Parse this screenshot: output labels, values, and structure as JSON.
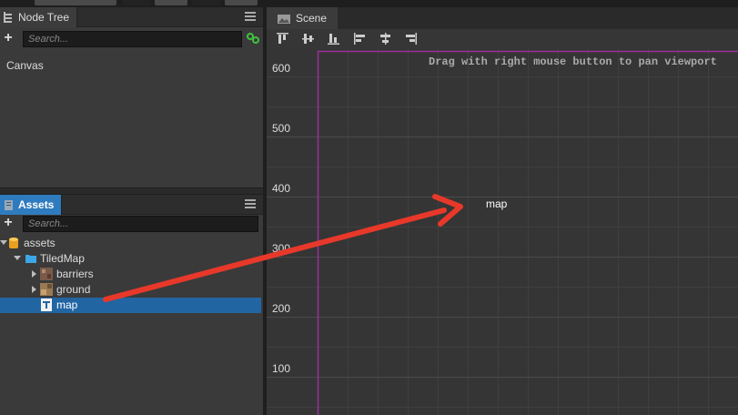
{
  "node_tree": {
    "tab_label": "Node Tree",
    "search_placeholder": "Search...",
    "root_label": "Canvas"
  },
  "assets": {
    "tab_label": "Assets",
    "search_placeholder": "Search...",
    "items": [
      {
        "label": "assets"
      },
      {
        "label": "TiledMap"
      },
      {
        "label": "barriers"
      },
      {
        "label": "ground"
      },
      {
        "label": "map"
      }
    ]
  },
  "scene": {
    "tab_label": "Scene",
    "hint": "Drag with right mouse button to pan viewport",
    "map_label": "map",
    "ruler_labels": [
      "600",
      "500",
      "400",
      "300",
      "200",
      "100"
    ]
  },
  "colors": {
    "accent_blue": "#2f7bbf",
    "selection": "#2265a3",
    "canvas_border": "#9b2f9b",
    "arrow": "#e8382a"
  }
}
